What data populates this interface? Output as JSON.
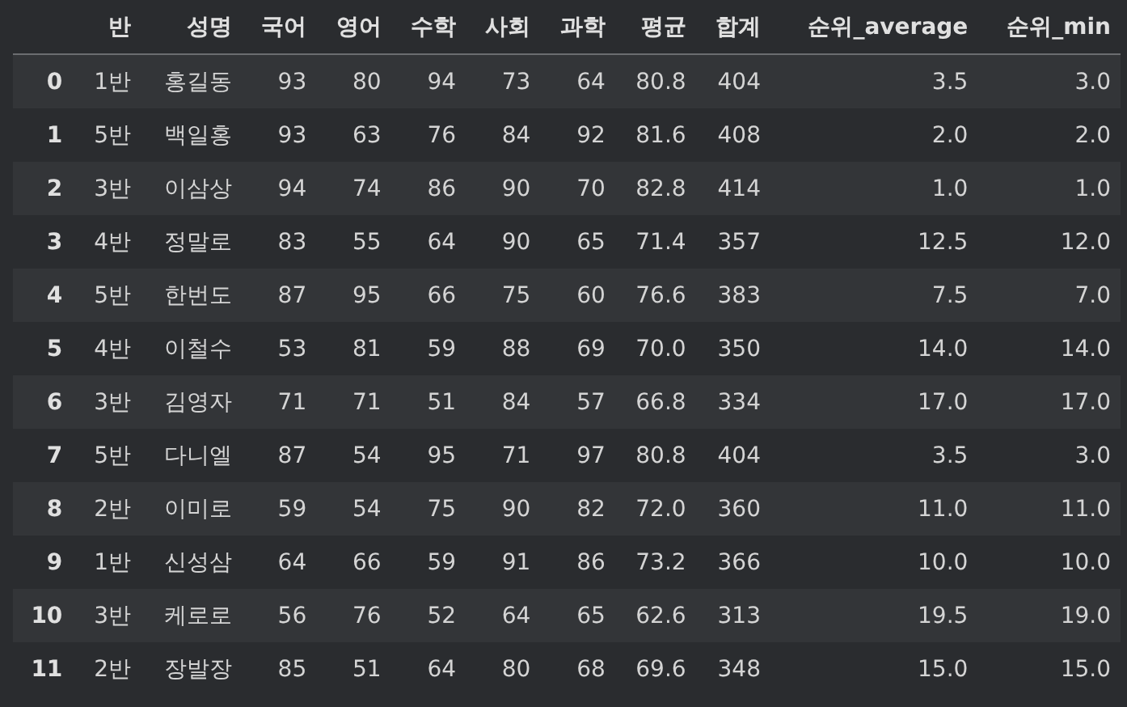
{
  "table": {
    "columns": [
      "반",
      "성명",
      "국어",
      "영어",
      "수학",
      "사회",
      "과학",
      "평균",
      "합계",
      "순위_average",
      "순위_min"
    ],
    "rows": [
      {
        "index": "0",
        "cells": [
          "1반",
          "홍길동",
          "93",
          "80",
          "94",
          "73",
          "64",
          "80.8",
          "404",
          "3.5",
          "3.0"
        ]
      },
      {
        "index": "1",
        "cells": [
          "5반",
          "백일홍",
          "93",
          "63",
          "76",
          "84",
          "92",
          "81.6",
          "408",
          "2.0",
          "2.0"
        ]
      },
      {
        "index": "2",
        "cells": [
          "3반",
          "이삼상",
          "94",
          "74",
          "86",
          "90",
          "70",
          "82.8",
          "414",
          "1.0",
          "1.0"
        ]
      },
      {
        "index": "3",
        "cells": [
          "4반",
          "정말로",
          "83",
          "55",
          "64",
          "90",
          "65",
          "71.4",
          "357",
          "12.5",
          "12.0"
        ]
      },
      {
        "index": "4",
        "cells": [
          "5반",
          "한번도",
          "87",
          "95",
          "66",
          "75",
          "60",
          "76.6",
          "383",
          "7.5",
          "7.0"
        ]
      },
      {
        "index": "5",
        "cells": [
          "4반",
          "이철수",
          "53",
          "81",
          "59",
          "88",
          "69",
          "70.0",
          "350",
          "14.0",
          "14.0"
        ]
      },
      {
        "index": "6",
        "cells": [
          "3반",
          "김영자",
          "71",
          "71",
          "51",
          "84",
          "57",
          "66.8",
          "334",
          "17.0",
          "17.0"
        ]
      },
      {
        "index": "7",
        "cells": [
          "5반",
          "다니엘",
          "87",
          "54",
          "95",
          "71",
          "97",
          "80.8",
          "404",
          "3.5",
          "3.0"
        ]
      },
      {
        "index": "8",
        "cells": [
          "2반",
          "이미로",
          "59",
          "54",
          "75",
          "90",
          "82",
          "72.0",
          "360",
          "11.0",
          "11.0"
        ]
      },
      {
        "index": "9",
        "cells": [
          "1반",
          "신성삼",
          "64",
          "66",
          "59",
          "91",
          "86",
          "73.2",
          "366",
          "10.0",
          "10.0"
        ]
      },
      {
        "index": "10",
        "cells": [
          "3반",
          "케로로",
          "56",
          "76",
          "52",
          "64",
          "65",
          "62.6",
          "313",
          "19.5",
          "19.0"
        ]
      },
      {
        "index": "11",
        "cells": [
          "2반",
          "장발장",
          "85",
          "51",
          "64",
          "80",
          "68",
          "69.6",
          "348",
          "15.0",
          "15.0"
        ]
      }
    ]
  }
}
